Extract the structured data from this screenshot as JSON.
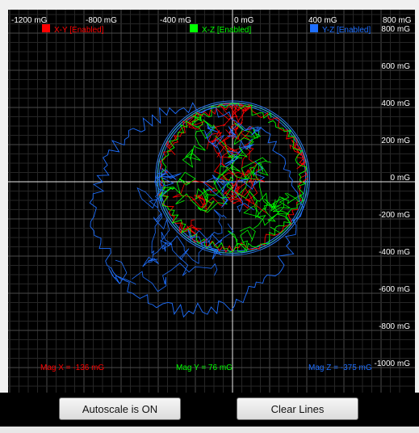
{
  "chart_data": {
    "type": "scatter",
    "title": "",
    "x_tick_labels": [
      "-1200 mG",
      "-800 mG",
      "-400 mG",
      "0 mG",
      "400 mG",
      "800 mG"
    ],
    "y_tick_labels": [
      "800 mG",
      "600 mG",
      "400 mG",
      "200 mG",
      "0 mG",
      "-200 mG",
      "-400 mG",
      "-600 mG",
      "-800 mG",
      "-1000 mG"
    ],
    "xlim": [
      -1200,
      800
    ],
    "ylim": [
      -1000,
      800
    ],
    "grid": true,
    "legend": [
      {
        "label": "X-Y [Enabled]",
        "color": "#ff0000"
      },
      {
        "label": "X-Z [Enabled]",
        "color": "#00ff00"
      },
      {
        "label": "Y-Z [Enabled]",
        "color": "#1e6fff"
      }
    ],
    "series": [
      {
        "name": "X-Y [Enabled]",
        "color": "#ff0000",
        "center": [
          0,
          20
        ],
        "radius": 400
      },
      {
        "name": "X-Z [Enabled]",
        "color": "#00ff00",
        "center": [
          0,
          20
        ],
        "radius": 400
      },
      {
        "name": "Y-Z [Enabled]",
        "color": "#1e6fff",
        "center": [
          -200,
          -150
        ],
        "radius": 570
      }
    ],
    "readouts": [
      {
        "label": "Mag X = -136 mG",
        "color": "#ff0000"
      },
      {
        "label": "Mag Y = 76 mG",
        "color": "#00ff00"
      },
      {
        "label": "Mag Z = -375 mG",
        "color": "#1e6fff"
      }
    ]
  },
  "buttons": {
    "autoscale": "Autoscale is ON",
    "clear": "Clear Lines"
  }
}
